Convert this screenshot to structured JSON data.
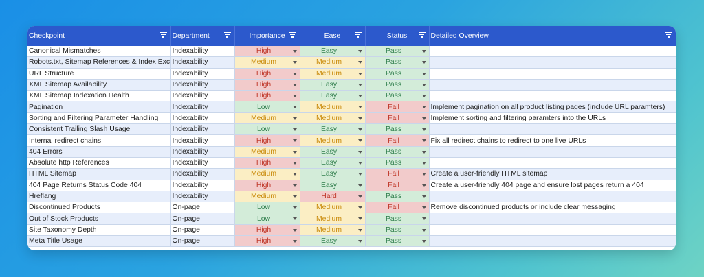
{
  "headers": [
    "Checkpoint",
    "Department",
    "Importance",
    "Ease",
    "Status",
    "Detailed Overview"
  ],
  "rows": [
    {
      "checkpoint": "Canonical Mismatches",
      "department": "Indexability",
      "importance": "High",
      "ease": "Easy",
      "status": "Pass",
      "overview": ""
    },
    {
      "checkpoint": "Robots.txt, Sitemap References & Index Exclusions",
      "department": "Indexability",
      "importance": "Medium",
      "ease": "Medium",
      "status": "Pass",
      "overview": ""
    },
    {
      "checkpoint": "URL Structure",
      "department": "Indexability",
      "importance": "High",
      "ease": "Medium",
      "status": "Pass",
      "overview": ""
    },
    {
      "checkpoint": "XML Sitemap Availability",
      "department": "Indexability",
      "importance": "High",
      "ease": "Easy",
      "status": "Pass",
      "overview": ""
    },
    {
      "checkpoint": "XML Sitemap Indexation Health",
      "department": "Indexability",
      "importance": "High",
      "ease": "Easy",
      "status": "Pass",
      "overview": ""
    },
    {
      "checkpoint": "Pagination",
      "department": "Indexability",
      "importance": "Low",
      "ease": "Medium",
      "status": "Fail",
      "overview": "Implement pagination on all product listing pages (include URL paramters)"
    },
    {
      "checkpoint": "Sorting and Filtering Parameter Handling",
      "department": "Indexability",
      "importance": "Medium",
      "ease": "Medium",
      "status": "Fail",
      "overview": "Implement sorting and filtering paramters into the URLs"
    },
    {
      "checkpoint": "Consistent Trailing Slash Usage",
      "department": "Indexability",
      "importance": "Low",
      "ease": "Easy",
      "status": "Pass",
      "overview": ""
    },
    {
      "checkpoint": "Internal redirect chains",
      "department": "Indexability",
      "importance": "High",
      "ease": "Medium",
      "status": "Fail",
      "overview": "Fix all redirect chains to redirect to one live URLs"
    },
    {
      "checkpoint": "404 Errors",
      "department": "Indexability",
      "importance": "Medium",
      "ease": "Easy",
      "status": "Pass",
      "overview": ""
    },
    {
      "checkpoint": "Absolute http References",
      "department": "Indexability",
      "importance": "High",
      "ease": "Easy",
      "status": "Pass",
      "overview": ""
    },
    {
      "checkpoint": "HTML Sitemap",
      "department": "Indexability",
      "importance": "Medium",
      "ease": "Easy",
      "status": "Fail",
      "overview": "Create a user-friendly HTML sitemap"
    },
    {
      "checkpoint": "404 Page Returns Status Code 404",
      "department": "Indexability",
      "importance": "High",
      "ease": "Easy",
      "status": "Fail",
      "overview": "Create a user-friendly 404 page and ensure lost pages return a 404"
    },
    {
      "checkpoint": "Hreflang",
      "department": "Indexability",
      "importance": "Medium",
      "ease": "Hard",
      "status": "Pass",
      "overview": ""
    },
    {
      "checkpoint": "Discontinued Products",
      "department": "On-page",
      "importance": "Low",
      "ease": "Medium",
      "status": "Fail",
      "overview": "Remove discontinued products or include clear messaging"
    },
    {
      "checkpoint": "Out of Stock Products",
      "department": "On-page",
      "importance": "Low",
      "ease": "Medium",
      "status": "Pass",
      "overview": ""
    },
    {
      "checkpoint": "Site Taxonomy Depth",
      "department": "On-page",
      "importance": "High",
      "ease": "Medium",
      "status": "Pass",
      "overview": ""
    },
    {
      "checkpoint": "Meta Title Usage",
      "department": "On-page",
      "importance": "High",
      "ease": "Easy",
      "status": "Pass",
      "overview": ""
    }
  ],
  "icons": {
    "filter": "filter-icon",
    "dropdown": "chevron-down-icon"
  }
}
